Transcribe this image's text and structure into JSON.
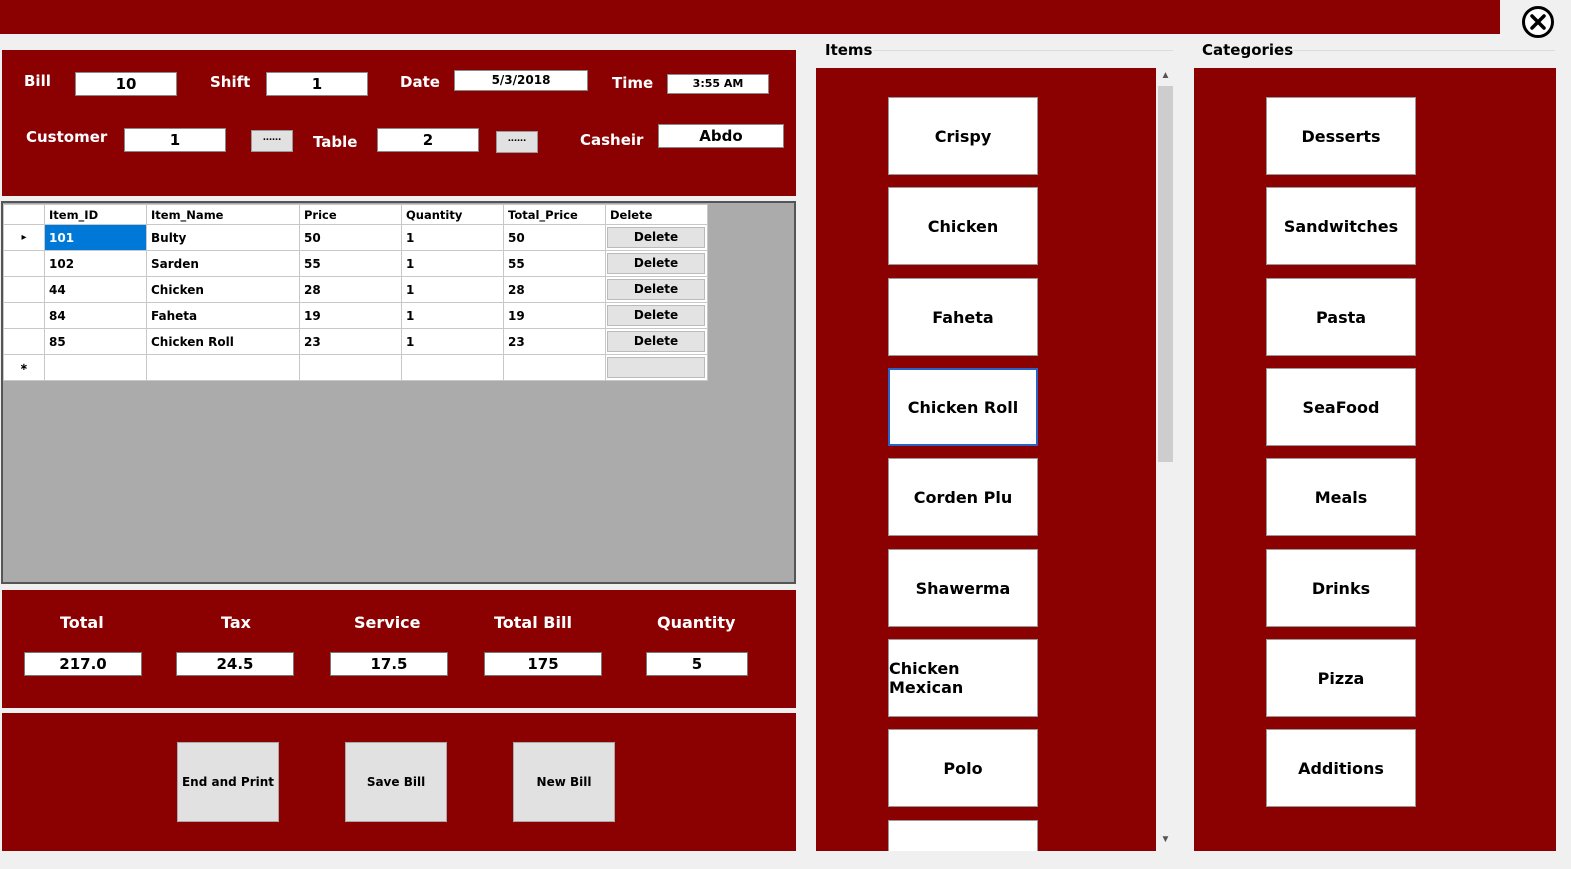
{
  "header": {
    "bill_label": "Bill",
    "bill_value": "10",
    "shift_label": "Shift",
    "shift_value": "1",
    "date_label": "Date",
    "date_value": "5/3/2018",
    "time_label": "Time",
    "time_value": "3:55 AM",
    "customer_label": "Customer",
    "customer_value": "1",
    "table_label": "Table",
    "table_value": "2",
    "cashier_label": "Casheir",
    "cashier_value": "Abdo",
    "browse_label": "......"
  },
  "grid": {
    "columns": [
      "Item_ID",
      "Item_Name",
      "Price",
      "Quantity",
      "Total_Price",
      "Delete"
    ],
    "delete_label": "Delete",
    "rows": [
      {
        "id": "101",
        "name": "Bulty",
        "price": "50",
        "qty": "1",
        "total": "50"
      },
      {
        "id": "102",
        "name": "Sarden",
        "price": "55",
        "qty": "1",
        "total": "55"
      },
      {
        "id": "44",
        "name": "Chicken",
        "price": "28",
        "qty": "1",
        "total": "28"
      },
      {
        "id": "84",
        "name": "Faheta",
        "price": "19",
        "qty": "1",
        "total": "19"
      },
      {
        "id": "85",
        "name": "Chicken Roll",
        "price": "23",
        "qty": "1",
        "total": "23"
      }
    ]
  },
  "summary": {
    "total_label": "Total",
    "total_value": "217.0",
    "tax_label": "Tax",
    "tax_value": "24.5",
    "service_label": "Service",
    "service_value": "17.5",
    "total_bill_label": "Total Bill",
    "total_bill_value": "175",
    "quantity_label": "Quantity",
    "quantity_value": "5"
  },
  "actions": {
    "end_print": "End and Print",
    "save_bill": "Save Bill",
    "new_bill": "New Bill"
  },
  "items": {
    "title": "Items",
    "buttons": [
      "Crispy",
      "Chicken",
      "Faheta",
      "Chicken Roll",
      "Corden Plu",
      "Shawerma",
      "Chicken Mexican",
      "Polo"
    ]
  },
  "categories": {
    "title": "Categories",
    "buttons": [
      "Desserts",
      "Sandwitches",
      "Pasta",
      "SeaFood",
      "Meals",
      "Drinks",
      "Pizza",
      "Additions"
    ]
  },
  "colors": {
    "panel": "#8b0000",
    "selected_cell": "#0078d7",
    "grid_bg": "#ababab"
  }
}
